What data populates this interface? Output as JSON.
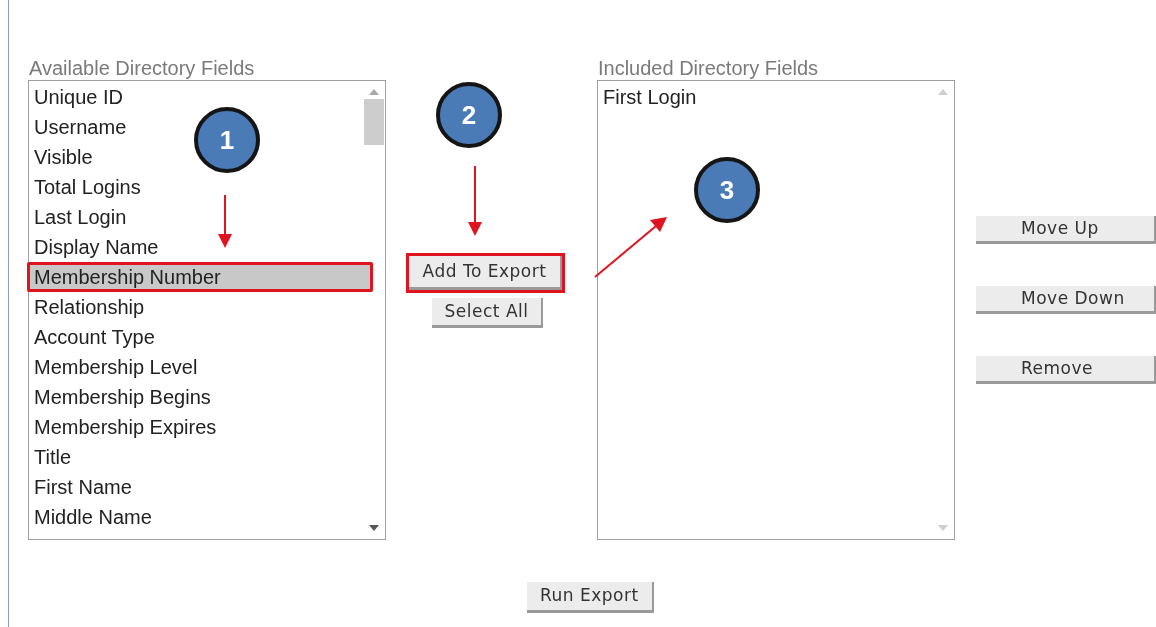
{
  "available": {
    "label": "Available Directory Fields",
    "items": [
      {
        "text": "Unique ID",
        "selected": false,
        "annotated": false
      },
      {
        "text": "Username",
        "selected": false,
        "annotated": false
      },
      {
        "text": "Visible",
        "selected": false,
        "annotated": false
      },
      {
        "text": "Total Logins",
        "selected": false,
        "annotated": false
      },
      {
        "text": "Last Login",
        "selected": false,
        "annotated": false
      },
      {
        "text": "Display Name",
        "selected": false,
        "annotated": false
      },
      {
        "text": "Membership Number",
        "selected": true,
        "annotated": true
      },
      {
        "text": "Relationship",
        "selected": false,
        "annotated": false
      },
      {
        "text": "Account Type",
        "selected": false,
        "annotated": false
      },
      {
        "text": "Membership Level",
        "selected": false,
        "annotated": false
      },
      {
        "text": "Membership Begins",
        "selected": false,
        "annotated": false
      },
      {
        "text": "Membership Expires",
        "selected": false,
        "annotated": false
      },
      {
        "text": "Title",
        "selected": false,
        "annotated": false
      },
      {
        "text": "First Name",
        "selected": false,
        "annotated": false
      },
      {
        "text": "Middle Name",
        "selected": false,
        "annotated": false
      }
    ]
  },
  "middle_buttons": [
    {
      "label": "Add To Export",
      "annotated": true
    },
    {
      "label": "Select All",
      "annotated": false
    }
  ],
  "included": {
    "label": "Included Directory Fields",
    "items": [
      {
        "text": "First Login",
        "selected": false,
        "annotated": false
      }
    ]
  },
  "side_buttons": [
    "Move Up",
    "Move Down",
    "Remove"
  ],
  "run_button": "Run Export",
  "callouts": [
    "1",
    "2",
    "3"
  ]
}
